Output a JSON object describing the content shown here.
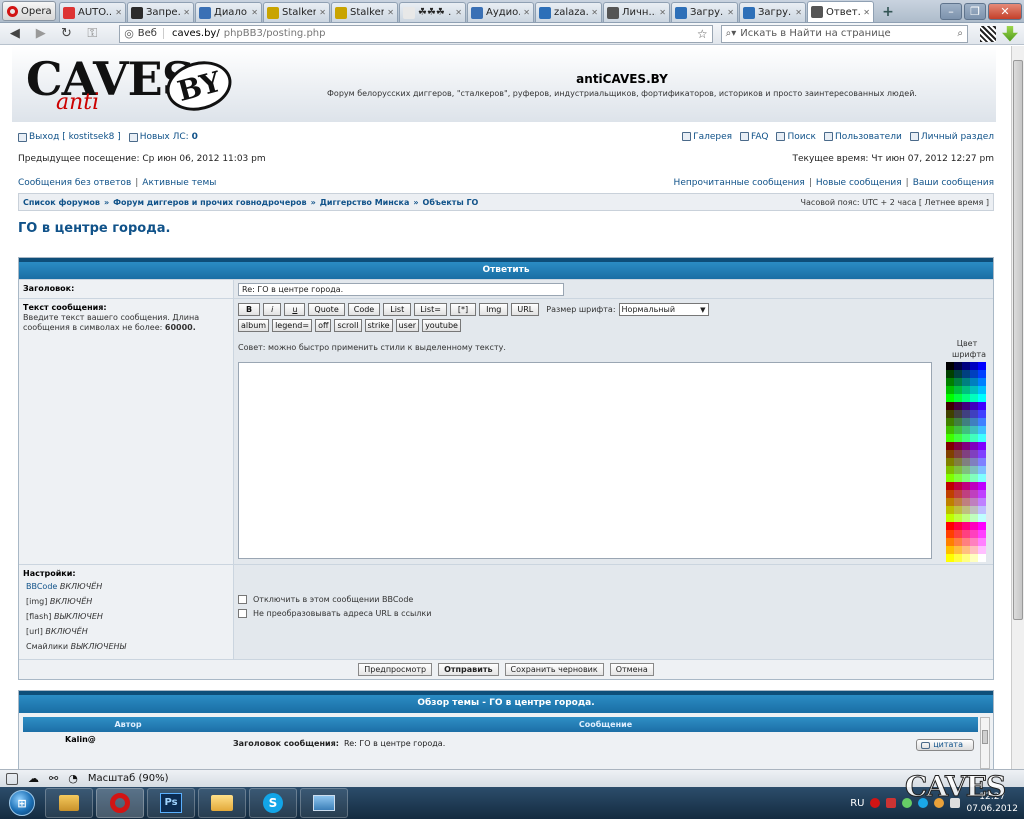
{
  "browser": {
    "menu_label": "Opera",
    "tabs": [
      {
        "label": "AUTO....",
        "icon_color": "#d33",
        "active": false
      },
      {
        "label": "Запре...",
        "icon_color": "#2b2b2b",
        "active": false
      },
      {
        "label": "Диало...",
        "icon_color": "#3a70b5",
        "active": false
      },
      {
        "label": "Stalker...",
        "icon_color": "#c9a400",
        "active": false
      },
      {
        "label": "Stalker...",
        "icon_color": "#c9a400",
        "active": false
      },
      {
        "label": "☘☘☘ ...",
        "icon_color": "#e8e8e8",
        "active": false
      },
      {
        "label": "Аудио...",
        "icon_color": "#3a70b5",
        "active": false
      },
      {
        "label": "zalaza...",
        "icon_color": "#2d6fb8",
        "active": false
      },
      {
        "label": "Личн...",
        "icon_color": "#555",
        "active": false
      },
      {
        "label": "Загру...",
        "icon_color": "#2d6fb8",
        "active": false
      },
      {
        "label": "Загру...",
        "icon_color": "#2d6fb8",
        "active": false
      },
      {
        "label": "Ответ...",
        "icon_color": "#555",
        "active": true
      }
    ],
    "address": {
      "scheme_label": "Веб",
      "host": "caves.by/",
      "path": "phpBB3/posting.php"
    },
    "search_placeholder": "Искать в Найти на странице"
  },
  "site": {
    "logo_caves": "CAVES",
    "logo_anti": "anti",
    "logo_by": "BY",
    "title": "antiCAVES.BY",
    "description": "Форум белорусских диггеров, \"сталкеров\", руферов, индустриальщиков, фортификаторов, историков и просто заинтересованных людей."
  },
  "userbar": {
    "logout": "Выход [ kostitsek8 ]",
    "new_pm_label": "Новых ЛС:",
    "new_pm_count": "0",
    "links": [
      "Галерея",
      "FAQ",
      "Поиск",
      "Пользователи",
      "Личный раздел"
    ],
    "last_visit": "Предыдущее посещение: Ср июн 06, 2012 11:03 pm",
    "current_time": "Текущее время: Чт июн 07, 2012 12:27 pm"
  },
  "quicklinks": {
    "left": [
      "Сообщения без ответов",
      "Активные темы"
    ],
    "right": [
      "Непрочитанные сообщения",
      "Новые сообщения",
      "Ваши сообщения"
    ]
  },
  "breadcrumb": {
    "items": [
      "Список форумов",
      "Форум диггеров и прочих говнодрочеров",
      "Диггерство Минска",
      "Объекты ГО"
    ],
    "timezone": "Часовой пояс: UTC + 2 часа [ Летнее время ]"
  },
  "topic_title": "ГО в центре города.",
  "post_form": {
    "header": "Ответить",
    "subject_label": "Заголовок:",
    "subject_value": "Re: ГО в центре города.",
    "message_label": "Текст сообщения:",
    "message_hint": "Введите текст вашего сообщения. Длина сообщения в символах не более:",
    "message_limit": "60000.",
    "bbcode_row1": [
      "B",
      "i",
      "u",
      "Quote",
      "Code",
      "List",
      "List=",
      "[*]",
      "Img",
      "URL"
    ],
    "bbcode_row2": [
      "album",
      "legend=",
      "off",
      "scroll",
      "strike",
      "user",
      "youtube"
    ],
    "font_size_label": "Размер шрифта:",
    "font_size_value": "Нормальный",
    "tip": "Совет: можно быстро применить стили к выделенному тексту.",
    "color_label": "Цвет шрифта",
    "palette": [
      "#000000",
      "#000040",
      "#000080",
      "#0000bf",
      "#0000ff",
      "#004000",
      "#004040",
      "#004080",
      "#0040bf",
      "#0040ff",
      "#008000",
      "#008040",
      "#008080",
      "#0080bf",
      "#0080ff",
      "#00bf00",
      "#00bf40",
      "#00bf80",
      "#00bfbf",
      "#00bfff",
      "#00ff00",
      "#00ff40",
      "#00ff80",
      "#00ffbf",
      "#00ffff",
      "#400000",
      "#400040",
      "#400080",
      "#4000bf",
      "#4000ff",
      "#404000",
      "#404040",
      "#404080",
      "#4040bf",
      "#4040ff",
      "#408000",
      "#408040",
      "#408080",
      "#4080bf",
      "#4080ff",
      "#40bf00",
      "#40bf40",
      "#40bf80",
      "#40bfbf",
      "#40bfff",
      "#40ff00",
      "#40ff40",
      "#40ff80",
      "#40ffbf",
      "#40ffff",
      "#800000",
      "#800040",
      "#800080",
      "#8000bf",
      "#8000ff",
      "#804000",
      "#804040",
      "#804080",
      "#8040bf",
      "#8040ff",
      "#808000",
      "#808040",
      "#808080",
      "#8080bf",
      "#8080ff",
      "#80bf00",
      "#80bf40",
      "#80bf80",
      "#80bfbf",
      "#80bfff",
      "#80ff00",
      "#80ff40",
      "#80ff80",
      "#80ffbf",
      "#80ffff",
      "#bf0000",
      "#bf0040",
      "#bf0080",
      "#bf00bf",
      "#bf00ff",
      "#bf4000",
      "#bf4040",
      "#bf4080",
      "#bf40bf",
      "#bf40ff",
      "#bf8000",
      "#bf8040",
      "#bf8080",
      "#bf80bf",
      "#bf80ff",
      "#bfbf00",
      "#bfbf40",
      "#bfbf80",
      "#bfbfbf",
      "#bfbfff",
      "#bfff00",
      "#bfff40",
      "#bfff80",
      "#bfffbf",
      "#bfffff",
      "#ff0000",
      "#ff0040",
      "#ff0080",
      "#ff00bf",
      "#ff00ff",
      "#ff4000",
      "#ff4040",
      "#ff4080",
      "#ff40bf",
      "#ff40ff",
      "#ff8000",
      "#ff8040",
      "#ff8080",
      "#ff80bf",
      "#ff80ff",
      "#ffbf00",
      "#ffbf40",
      "#ffbf80",
      "#ffbfbf",
      "#ffbfff",
      "#ffff00",
      "#ffff40",
      "#ffff80",
      "#ffffbf",
      "#ffffff"
    ],
    "settings_label": "Настройки:",
    "settings": [
      {
        "name": "BBCode",
        "state": "ВКЛЮЧЁН",
        "link": true
      },
      {
        "name": "[img]",
        "state": "ВКЛЮЧЁН",
        "link": false
      },
      {
        "name": "[flash]",
        "state": "ВЫКЛЮЧЕН",
        "link": false
      },
      {
        "name": "[url]",
        "state": "ВКЛЮЧЁН",
        "link": false
      },
      {
        "name": "Смайлики",
        "state": "ВЫКЛЮЧЕНЫ",
        "link": false
      }
    ],
    "options": [
      "Отключить в этом сообщении BBCode",
      "Не преобразовывать адреса URL в ссылки"
    ],
    "buttons": [
      "Предпросмотр",
      "Отправить",
      "Сохранить черновик",
      "Отмена"
    ]
  },
  "topic_review": {
    "header": "Обзор темы - ГО в центре города.",
    "col_author": "Автор",
    "col_message": "Сообщение",
    "post_author": "Kalin@",
    "post_subject_label": "Заголовок сообщения:",
    "post_subject": "Re: ГО в центре города.",
    "quote_label": "цитата"
  },
  "statusbar": {
    "zoom": "Масштаб (90%)"
  },
  "taskbar": {
    "apps": [
      "",
      "",
      "Ps",
      "",
      "S",
      ""
    ],
    "language": "RU",
    "time": "12:27",
    "date": "07.06.2012",
    "watermark": "CAVES"
  }
}
